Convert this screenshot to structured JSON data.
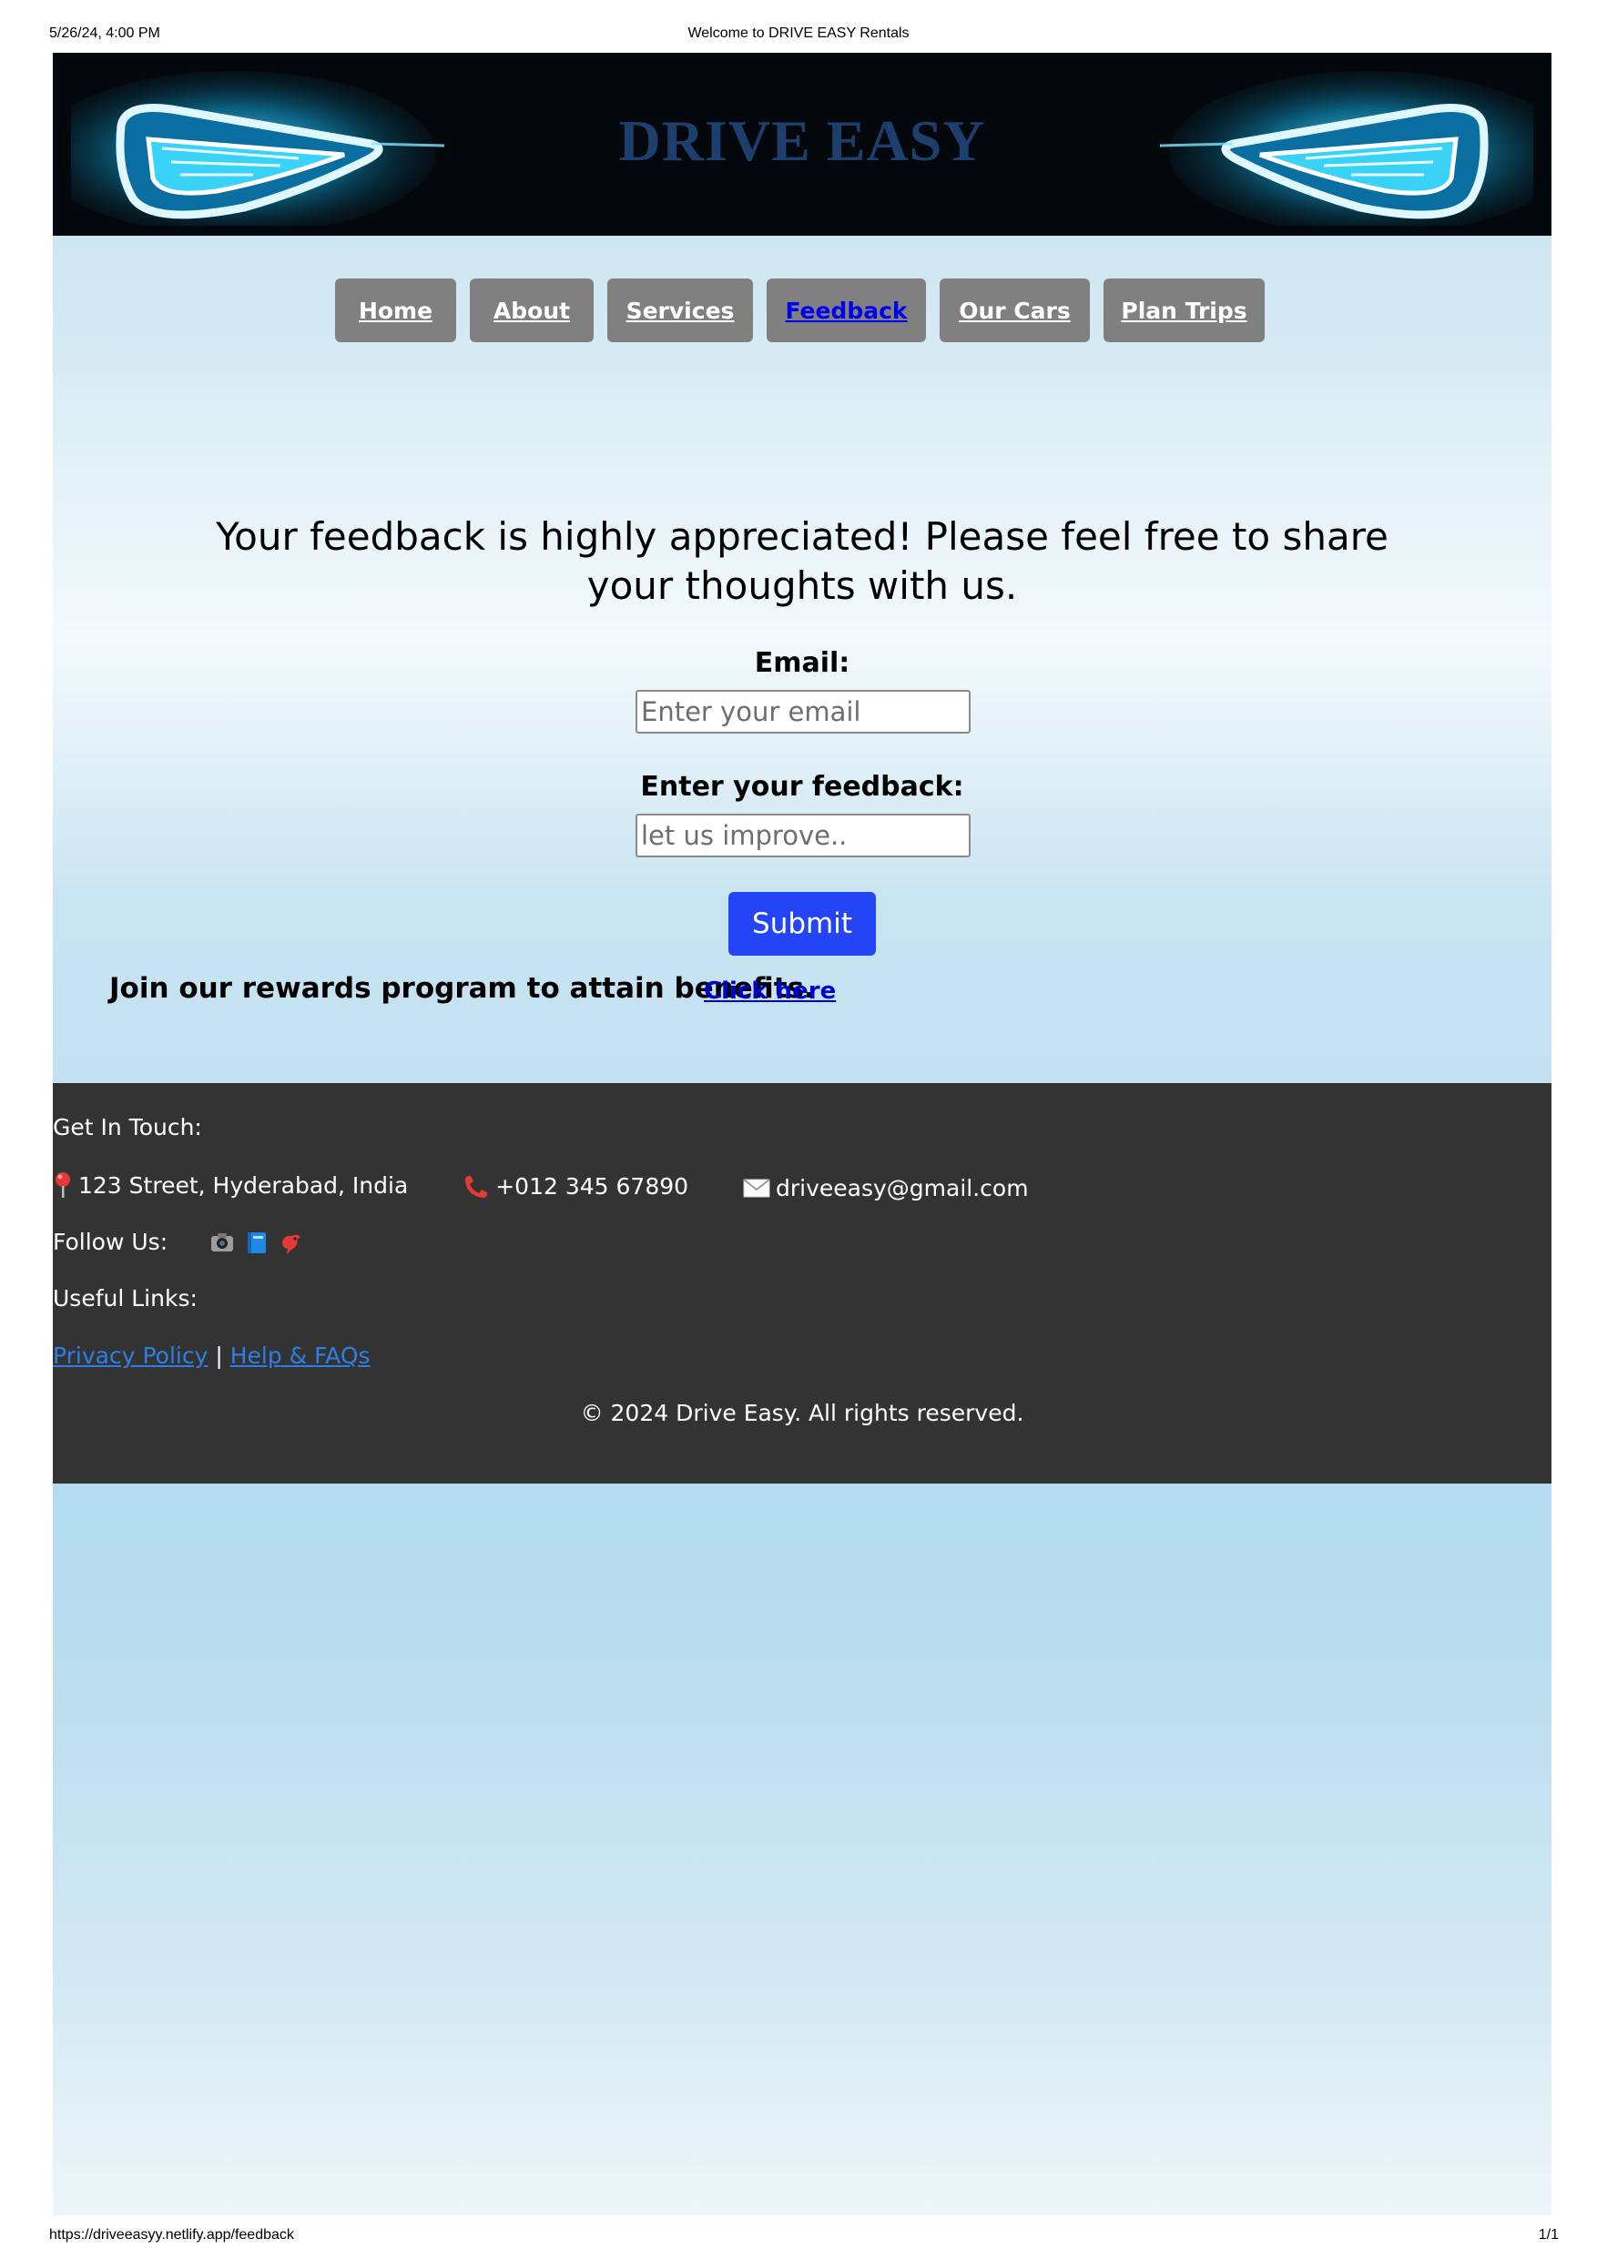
{
  "print": {
    "date": "5/26/24, 4:00 PM",
    "title": "Welcome to DRIVE EASY Rentals",
    "url": "https://driveeasyy.netlify.app/feedback",
    "page": "1/1"
  },
  "banner": {
    "brand": "DRIVE EASY",
    "brand_color": "#1d3f6e",
    "glow_color": "#22c8f5"
  },
  "nav": {
    "items": [
      {
        "label": "Home"
      },
      {
        "label": "About"
      },
      {
        "label": "Services"
      },
      {
        "label": "Feedback",
        "active": true
      },
      {
        "label": "Our Cars"
      },
      {
        "label": "Plan Trips"
      }
    ]
  },
  "feedback": {
    "heading": "Your feedback is highly appreciated! Please feel free to share your thoughts with us.",
    "email_label": "Email:",
    "email_placeholder": "Enter your email",
    "feedback_label": "Enter your feedback:",
    "feedback_placeholder": "let us improve..",
    "submit_label": "Submit"
  },
  "rewards": {
    "text": "Join our rewards program to attain benefits.",
    "link": "Click here"
  },
  "footer": {
    "get_in_touch": "Get In Touch:",
    "address": "123 Street, Hyderabad, India",
    "phone": "+012 345 67890",
    "email": "driveeasy@gmail.com",
    "follow_us": "Follow Us:",
    "social": [
      "camera-icon",
      "book-icon",
      "bird-icon"
    ],
    "useful_links": "Useful Links:",
    "privacy": "Privacy Policy",
    "separator": "|",
    "help": "Help & FAQs",
    "copyright": "© 2024 Drive Easy. All rights reserved."
  }
}
